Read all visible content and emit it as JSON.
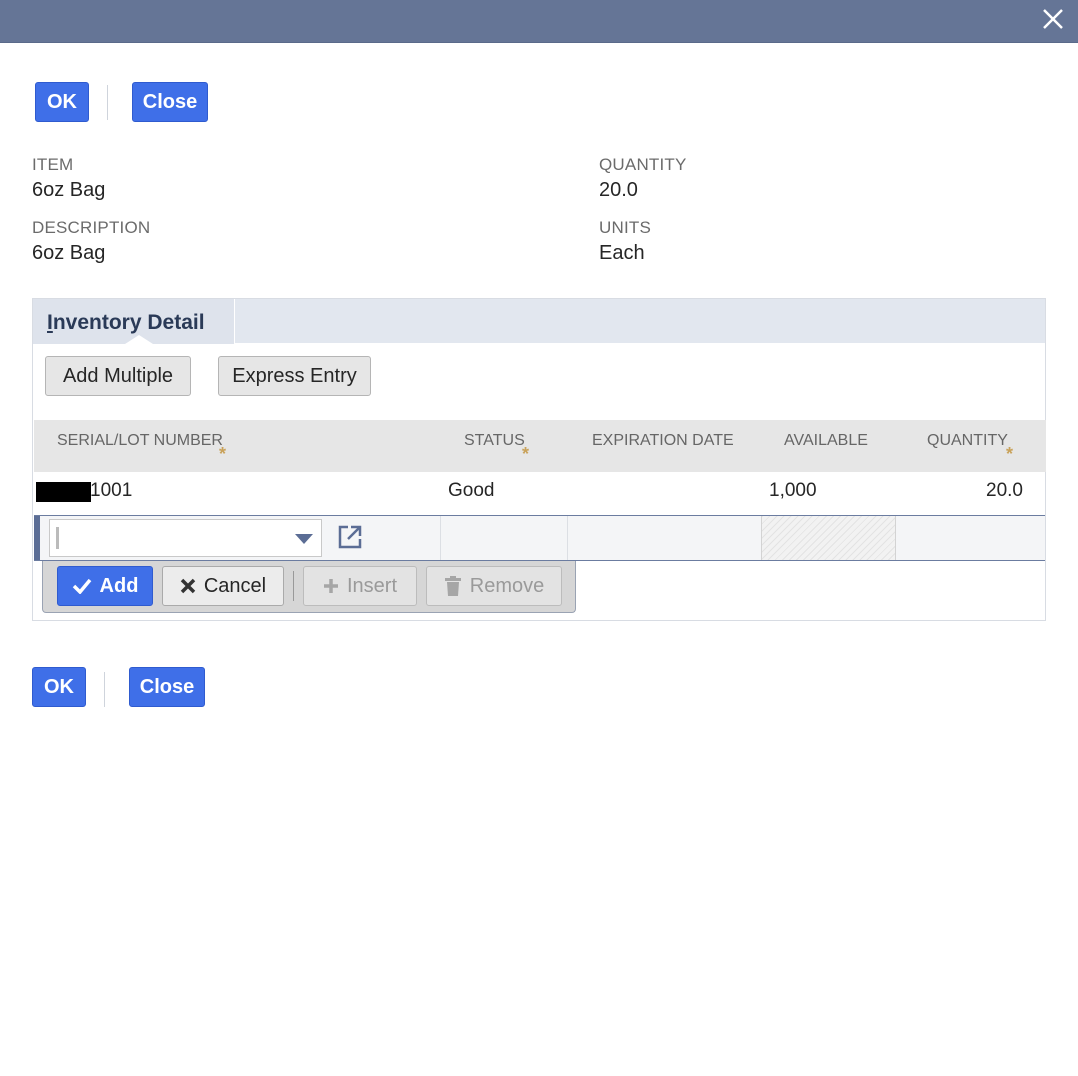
{
  "dialog": {
    "close_icon": "close-icon"
  },
  "top_actions": {
    "ok_label": "OK",
    "close_label": "Close"
  },
  "bottom_actions": {
    "ok_label": "OK",
    "close_label": "Close"
  },
  "fields": {
    "item_label": "ITEM",
    "item_value": "6oz Bag",
    "description_label": "DESCRIPTION",
    "description_value": "6oz Bag",
    "quantity_label": "QUANTITY",
    "quantity_value": "20.0",
    "units_label": "UNITS",
    "units_value": "Each"
  },
  "inventory": {
    "tab_label_underlined": "I",
    "tab_label_rest": "nventory Detail",
    "add_multiple_label": "Add Multiple",
    "express_entry_label": "Express Entry",
    "columns": {
      "serial": "SERIAL/LOT NUMBER",
      "status": "STATUS",
      "expiration": "EXPIRATION DATE",
      "available": "AVAILABLE",
      "quantity": "QUANTITY"
    },
    "required_marker": "*",
    "rows": [
      {
        "serial_suffix": "1001",
        "status": "Good",
        "expiration": "",
        "available": "1,000",
        "quantity": "20.0"
      }
    ],
    "actions": {
      "add": "Add",
      "cancel": "Cancel",
      "insert": "Insert",
      "remove": "Remove"
    }
  },
  "colors": {
    "titlebar": "#657596",
    "primary": "#3f6fe8",
    "required": "#c9a25a"
  }
}
